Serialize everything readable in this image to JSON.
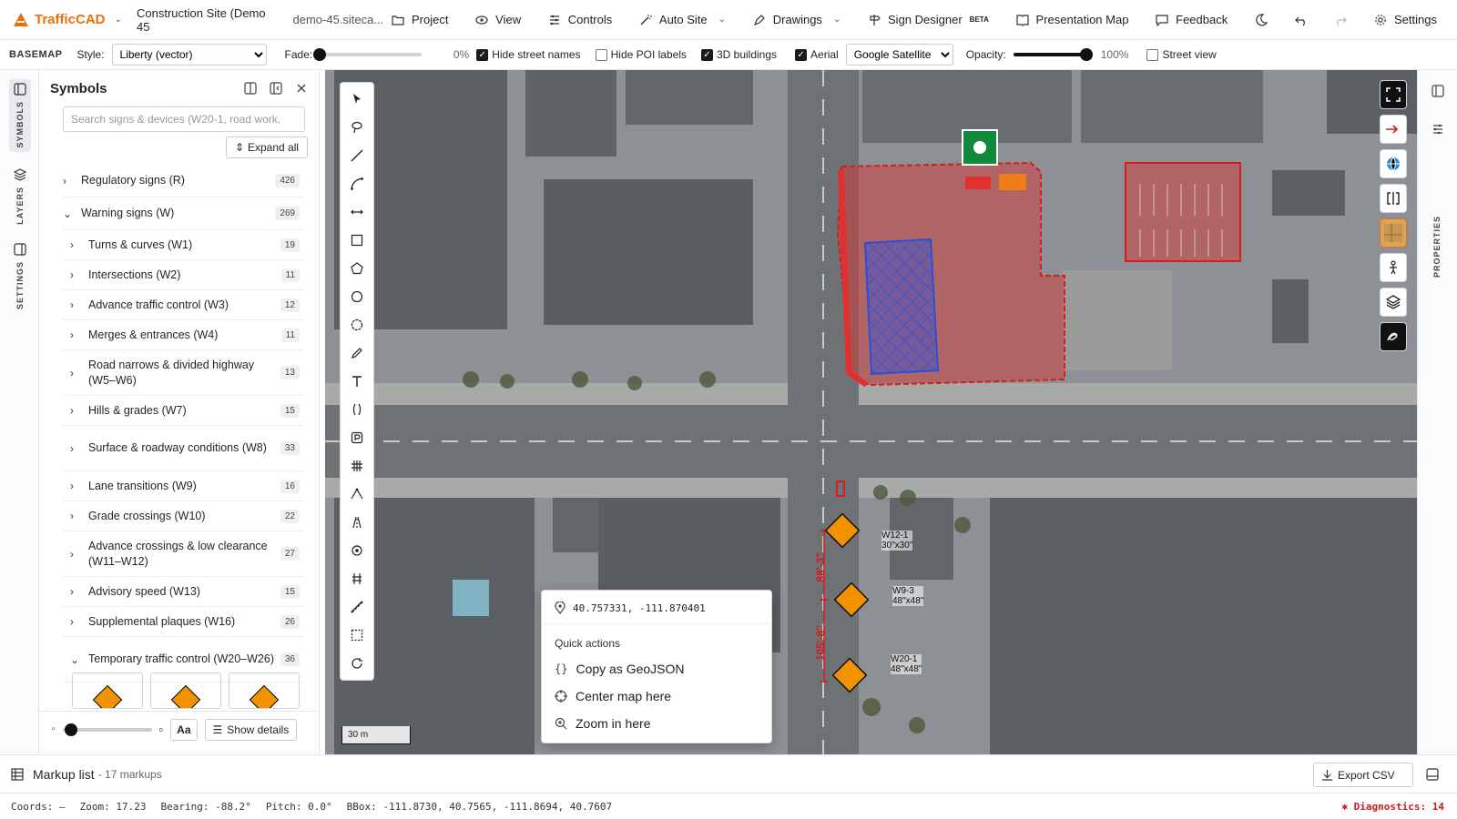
{
  "app": {
    "name": "TrafficCAD",
    "project_name": "Construction Site (Demo 45",
    "project_url": "demo-45.siteca..."
  },
  "menu": [
    {
      "id": "project",
      "label": "Project",
      "icon": "folder-icon"
    },
    {
      "id": "view",
      "label": "View",
      "icon": "eye-icon"
    },
    {
      "id": "controls",
      "label": "Controls",
      "icon": "sliders-icon"
    },
    {
      "id": "auto_site",
      "label": "Auto Site",
      "icon": "wand-icon"
    },
    {
      "id": "drawings",
      "label": "Drawings",
      "icon": "pen-icon"
    },
    {
      "id": "sign_designer",
      "label": "Sign Designer",
      "badge": "BETA",
      "icon": "signpost-icon"
    },
    {
      "id": "presentation",
      "label": "Presentation Map",
      "icon": "book-icon"
    },
    {
      "id": "feedback",
      "label": "Feedback",
      "icon": "message-icon"
    },
    {
      "id": "settings",
      "label": "Settings",
      "icon": "gear-icon"
    }
  ],
  "basemap": {
    "label": "BASEMAP",
    "style_label": "Style:",
    "style_value": "Liberty (vector)",
    "fade_label": "Fade:",
    "fade_value": "0%",
    "fade_fraction": 0,
    "hide_street_names": {
      "label": "Hide street names",
      "checked": true
    },
    "hide_poi": {
      "label": "Hide POI labels",
      "checked": false
    },
    "buildings_3d": {
      "label": "3D buildings",
      "checked": true
    },
    "aerial": {
      "label": "Aerial",
      "checked": true
    },
    "aerial_source": "Google Satellite",
    "opacity_label": "Opacity:",
    "opacity_value": "100%",
    "opacity_fraction": 1,
    "street_view": {
      "label": "Street view",
      "checked": false
    }
  },
  "rail": {
    "symbols": "SYMBOLS",
    "layers": "LAYERS",
    "settings": "SETTINGS"
  },
  "panel": {
    "title": "Symbols",
    "search_placeholder": "Search signs & devices (W20-1, road work,",
    "expand_all": "Expand all",
    "categories": [
      {
        "label": "Regulatory signs (R)",
        "count": "426",
        "expanded": false,
        "level": 1
      },
      {
        "label": "Warning signs (W)",
        "count": "269",
        "expanded": true,
        "level": 1
      },
      {
        "label": "Turns & curves (W1)",
        "count": "19",
        "level": 2
      },
      {
        "label": "Intersections (W2)",
        "count": "11",
        "level": 2
      },
      {
        "label": "Advance traffic control (W3)",
        "count": "12",
        "level": 2
      },
      {
        "label": "Merges & entrances (W4)",
        "count": "11",
        "level": 2
      },
      {
        "label": "Road narrows & divided highway (W5–W6)",
        "count": "13",
        "level": 2
      },
      {
        "label": "Hills & grades (W7)",
        "count": "15",
        "level": 2
      },
      {
        "label": "Surface & roadway conditions (W8)",
        "count": "33",
        "level": 2
      },
      {
        "label": "Lane transitions (W9)",
        "count": "16",
        "level": 2
      },
      {
        "label": "Grade crossings (W10)",
        "count": "22",
        "level": 2
      },
      {
        "label": "Advance crossings & low clearance (W11–W12)",
        "count": "27",
        "level": 2
      },
      {
        "label": "Advisory speed (W13)",
        "count": "15",
        "level": 2
      },
      {
        "label": "Supplemental plaques (W16)",
        "count": "26",
        "level": 2
      },
      {
        "label": "Temporary traffic control (W20–W26)",
        "count": "36",
        "level": 2,
        "expanded": true
      }
    ],
    "text_size_label": "Aa",
    "show_details": "Show details",
    "size_fraction": 0.02
  },
  "map": {
    "scale": "30 m",
    "signs": [
      {
        "code": "W12-1",
        "size": "30\"x30\""
      },
      {
        "code": "W9-3",
        "size": "48\"x48\""
      },
      {
        "code": "W20-1",
        "size": "48\"x48\""
      }
    ],
    "dimensions": [
      "88'-3\"",
      "105'-8\""
    ],
    "context_menu": {
      "coords": "40.757331, -111.870401",
      "heading": "Quick actions",
      "items": [
        {
          "label": "Copy as GeoJSON",
          "icon": "braces-icon"
        },
        {
          "label": "Center map here",
          "icon": "crosshair-icon"
        },
        {
          "label": "Zoom in here",
          "icon": "zoom-in-icon"
        }
      ]
    }
  },
  "properties_label": "PROPERTIES",
  "markup": {
    "title": "Markup list",
    "count": "- 17 markups",
    "export": "Export CSV"
  },
  "status": {
    "coords": "Coords: —",
    "zoom": "Zoom: 17.23",
    "bearing": "Bearing: -88.2°",
    "pitch": "Pitch: 0.0°",
    "bbox": "BBox: -111.8730, 40.7565, -111.8694, 40.7607",
    "diagnostics": "Diagnostics: 14"
  },
  "colors": {
    "brand": "#e8710a",
    "zone_red": "#e0312f",
    "zone_blue": "#2b4fd6",
    "sign_orange": "#f39200",
    "diag": "#c81e1e"
  }
}
